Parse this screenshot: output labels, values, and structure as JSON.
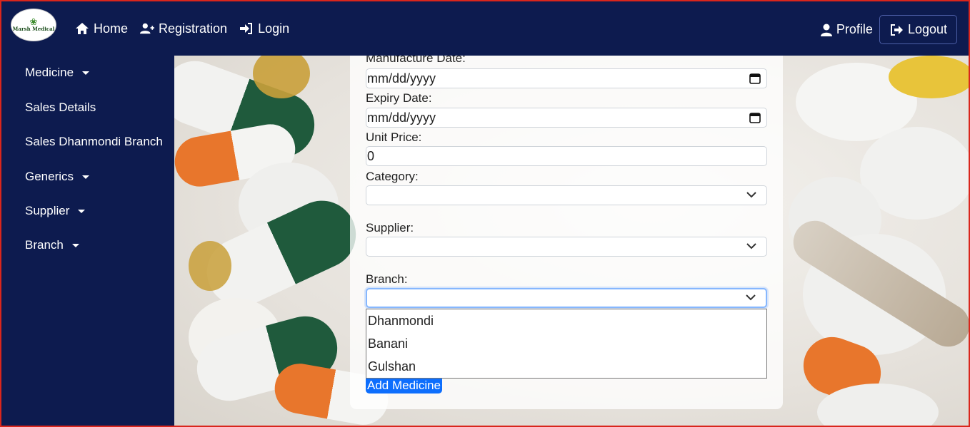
{
  "navbar": {
    "logo_text": "Marsh Medical",
    "links": [
      {
        "label": "Home",
        "icon": "home-icon"
      },
      {
        "label": "Registration",
        "icon": "user-plus-icon"
      },
      {
        "label": "Login",
        "icon": "sign-in-icon"
      }
    ],
    "profile_label": "Profile",
    "logout_label": "Logout"
  },
  "sidebar": {
    "items": [
      {
        "label": "Medicine",
        "has_caret": true
      },
      {
        "label": "Sales Details",
        "has_caret": false
      },
      {
        "label": "Sales Dhanmondi Branch",
        "has_caret": false
      },
      {
        "label": "Generics",
        "has_caret": true
      },
      {
        "label": "Supplier",
        "has_caret": true
      },
      {
        "label": "Branch",
        "has_caret": true
      }
    ]
  },
  "form": {
    "manufacture_label": "Manufacture Date:",
    "manufacture_value": "mm/dd/yyyy",
    "expiry_label": "Expiry Date:",
    "expiry_value": "mm/dd/yyyy",
    "unit_price_label": "Unit Price:",
    "unit_price_value": "0",
    "category_label": "Category:",
    "category_value": "",
    "supplier_label": "Supplier:",
    "supplier_value": "",
    "branch_label": "Branch:",
    "branch_value": "",
    "branch_options": [
      "Dhanmondi",
      "Banani",
      "Gulshan"
    ],
    "submit_label": "Add Medicine"
  },
  "colors": {
    "navbar_bg": "#0d1b4f",
    "accent_button": "#0d6efd",
    "focus_border": "#86b7fe",
    "frame_border": "#d9261c"
  }
}
